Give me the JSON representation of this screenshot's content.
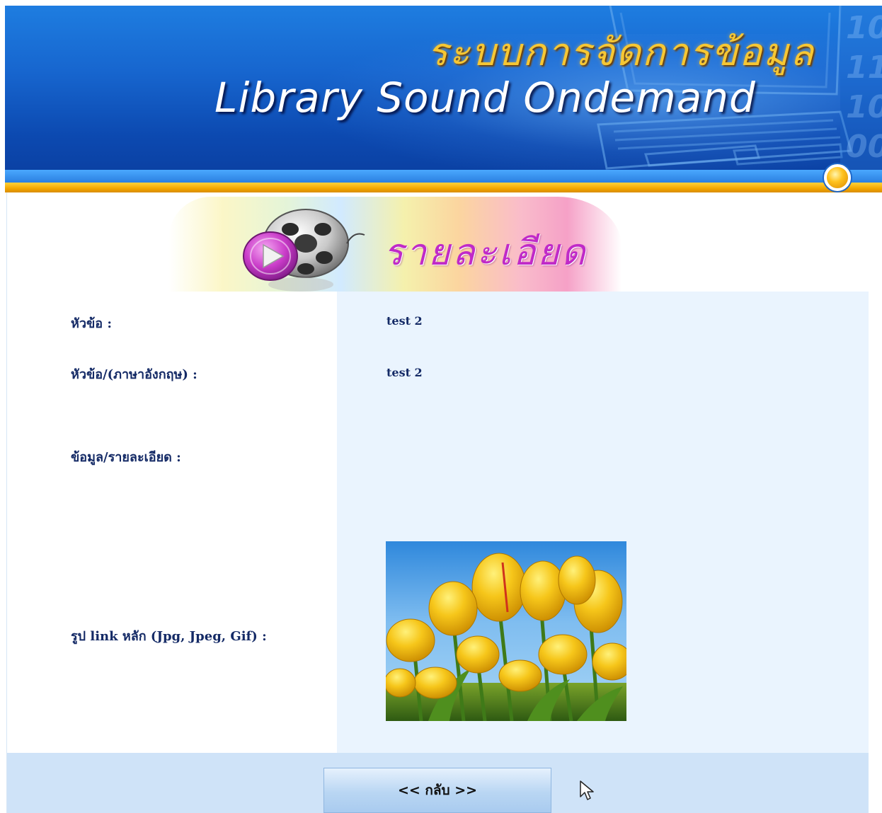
{
  "banner": {
    "title_th": "ระบบการจัดการข้อมูล",
    "title_en": "Library Sound Ondemand",
    "decor_digits": [
      "10",
      "11",
      "10",
      "00"
    ]
  },
  "section": {
    "title": "รายละเอียด",
    "icon": "film-reel-play-icon"
  },
  "details": {
    "rows": [
      {
        "label": "หัวข้อ :",
        "value": "test 2"
      },
      {
        "label": "หัวข้อ/(ภาษาอังกฤษ) :",
        "value": "test 2"
      },
      {
        "label": "ข้อมูล/รายละเอียด :",
        "value": ""
      },
      {
        "label": "รูป link หลัก (Jpg, Jpeg, Gif) :",
        "image": "yellow-tulips-photo"
      }
    ]
  },
  "footer": {
    "back_button_label": "<< กลับ >>"
  },
  "colors": {
    "banner_blue": "#1766cf",
    "banner_gold": "#f3a600",
    "label_text": "#142a66",
    "value_panel": "#eaf4fe",
    "footer_bg": "#cfe3f8",
    "section_title": "#c02ac8"
  }
}
